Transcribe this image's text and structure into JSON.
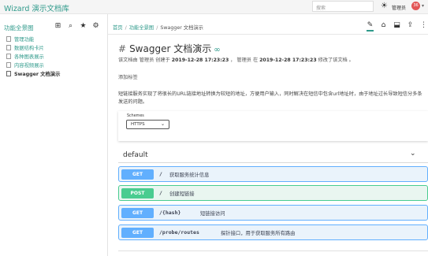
{
  "app": {
    "title": "Wizard 演示文档库"
  },
  "topbar": {
    "search_placeholder": "搜索",
    "user_name": "管理员",
    "notification_count": "36"
  },
  "sidebar": {
    "heading": "功能全景图",
    "items": [
      {
        "label": "管理功能"
      },
      {
        "label": "数据结构卡片"
      },
      {
        "label": "各种图表展示"
      },
      {
        "label": "内容视频展示"
      },
      {
        "label": "Swagger 文档演示"
      }
    ]
  },
  "breadcrumb": {
    "home": "首页",
    "section": "功能全景图",
    "current": "Swagger 文档演示"
  },
  "document": {
    "title": "Swagger 文档演示",
    "meta": {
      "t1": "该文档由 管理员 创建于 ",
      "created": "2019-12-28 17:23:23",
      "t2": " ，  管理员 在 ",
      "modified": "2019-12-28 17:23:23",
      "t3": " 修改了该文档 。"
    },
    "add_tag": "添加标签",
    "description": "短链接服务实现了将很长的URL链接地址转换为较短的地址，方便用户输入，同时解决在短信中包含url地址时，由于地址过长导致短信分多条发送的问题。"
  },
  "swagger": {
    "schemes_label": "Schemes",
    "schemes_value": "HTTPS",
    "tag": "default",
    "operations": [
      {
        "method": "GET",
        "path": "/",
        "summary": "获取服务统计信息"
      },
      {
        "method": "POST",
        "path": "/",
        "summary": "创建短链接"
      },
      {
        "method": "GET",
        "path": "/{hash}",
        "summary": "短链接访问"
      },
      {
        "method": "GET",
        "path": "/probe/routes",
        "summary": "探针接口，用于获取服务所有路由"
      }
    ]
  },
  "colors": {
    "brand": "#2f9a8b",
    "get": "#61affe",
    "post": "#49cc90",
    "badge": "#e25555"
  }
}
